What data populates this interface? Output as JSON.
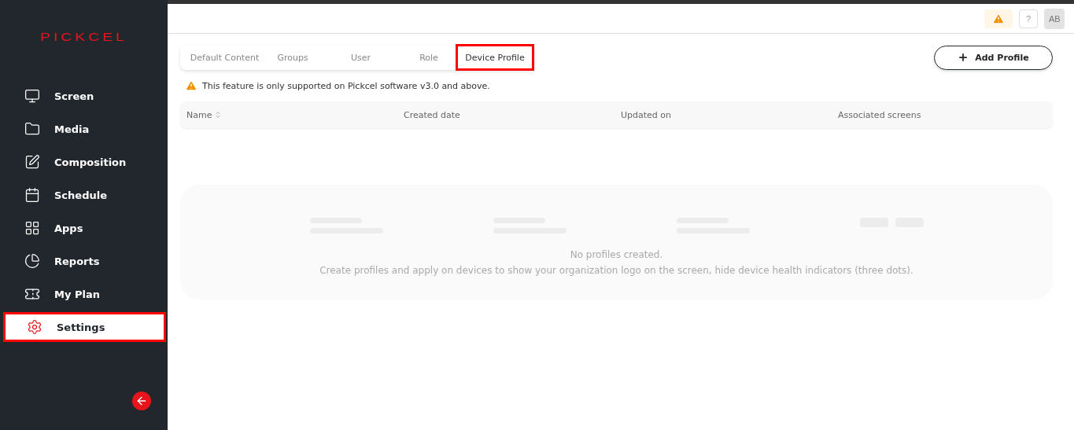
{
  "logo": "PICKCEL",
  "nav": [
    {
      "label": "Screen",
      "selected": false
    },
    {
      "label": "Media",
      "selected": false
    },
    {
      "label": "Composition",
      "selected": false
    },
    {
      "label": "Schedule",
      "selected": false
    },
    {
      "label": "Apps",
      "selected": false
    },
    {
      "label": "Reports",
      "selected": false
    },
    {
      "label": "My Plan",
      "selected": false
    },
    {
      "label": "Settings",
      "selected": true
    }
  ],
  "header": {
    "help": "?",
    "avatar": "AB"
  },
  "tabs": [
    {
      "label": "Default Content",
      "selected": false
    },
    {
      "label": "Groups",
      "selected": false
    },
    {
      "label": "User",
      "selected": false
    },
    {
      "label": "Role",
      "selected": false
    },
    {
      "label": "Device Profile",
      "selected": true
    }
  ],
  "add_button": "Add Profile",
  "notice": "This feature is only supported on Pickcel software v3.0 and above.",
  "table": {
    "columns": [
      {
        "label": "Name",
        "sortable": true
      },
      {
        "label": "Created date",
        "sortable": false
      },
      {
        "label": "Updated on",
        "sortable": false
      },
      {
        "label": "Associated screens",
        "sortable": false
      }
    ]
  },
  "empty": {
    "title": "No profiles created.",
    "message": "Create profiles and apply on devices to show your organization logo on the screen, hide device health indicators (three dots)."
  }
}
